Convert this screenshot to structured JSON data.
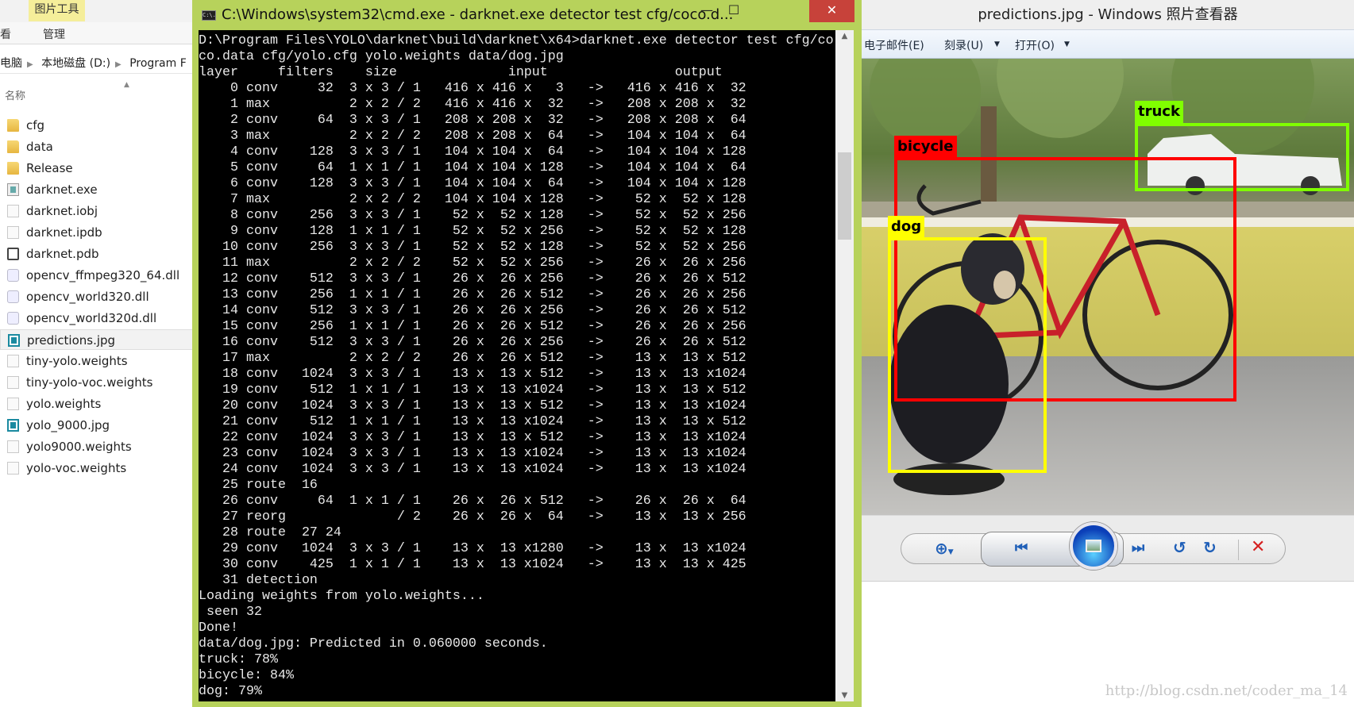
{
  "explorer": {
    "tool_tab": "图片工具",
    "ribbon_tabs": [
      "看",
      "管理"
    ],
    "breadcrumb": [
      "电脑",
      "本地磁盘 (D:)",
      "Program F"
    ],
    "column_name": "名称",
    "files": [
      {
        "name": "cfg",
        "icon": "folder"
      },
      {
        "name": "data",
        "icon": "folder"
      },
      {
        "name": "Release",
        "icon": "folder"
      },
      {
        "name": "darknet.exe",
        "icon": "exe"
      },
      {
        "name": "darknet.iobj",
        "icon": "doc"
      },
      {
        "name": "darknet.ipdb",
        "icon": "doc"
      },
      {
        "name": "darknet.pdb",
        "icon": "pdb"
      },
      {
        "name": "opencv_ffmpeg320_64.dll",
        "icon": "dll"
      },
      {
        "name": "opencv_world320.dll",
        "icon": "dll"
      },
      {
        "name": "opencv_world320d.dll",
        "icon": "dll"
      },
      {
        "name": "predictions.jpg",
        "icon": "img",
        "selected": true
      },
      {
        "name": "tiny-yolo.weights",
        "icon": "doc"
      },
      {
        "name": "tiny-yolo-voc.weights",
        "icon": "doc"
      },
      {
        "name": "yolo.weights",
        "icon": "doc"
      },
      {
        "name": "yolo_9000.jpg",
        "icon": "img"
      },
      {
        "name": "yolo9000.weights",
        "icon": "doc"
      },
      {
        "name": "yolo-voc.weights",
        "icon": "doc"
      }
    ]
  },
  "cmd": {
    "title": "C:\\Windows\\system32\\cmd.exe - darknet.exe  detector test cfg/coco.d...",
    "icon_text": "C:\\.",
    "minimize": "—",
    "maximize": "☐",
    "close": "✕",
    "lines": [
      "D:\\Program Files\\YOLO\\darknet\\build\\darknet\\x64>darknet.exe detector test cfg/co",
      "co.data cfg/yolo.cfg yolo.weights data/dog.jpg",
      "layer     filters    size              input                output",
      "    0 conv     32  3 x 3 / 1   416 x 416 x   3   ->   416 x 416 x  32",
      "    1 max          2 x 2 / 2   416 x 416 x  32   ->   208 x 208 x  32",
      "    2 conv     64  3 x 3 / 1   208 x 208 x  32   ->   208 x 208 x  64",
      "    3 max          2 x 2 / 2   208 x 208 x  64   ->   104 x 104 x  64",
      "    4 conv    128  3 x 3 / 1   104 x 104 x  64   ->   104 x 104 x 128",
      "    5 conv     64  1 x 1 / 1   104 x 104 x 128   ->   104 x 104 x  64",
      "    6 conv    128  3 x 3 / 1   104 x 104 x  64   ->   104 x 104 x 128",
      "    7 max          2 x 2 / 2   104 x 104 x 128   ->    52 x  52 x 128",
      "    8 conv    256  3 x 3 / 1    52 x  52 x 128   ->    52 x  52 x 256",
      "    9 conv    128  1 x 1 / 1    52 x  52 x 256   ->    52 x  52 x 128",
      "   10 conv    256  3 x 3 / 1    52 x  52 x 128   ->    52 x  52 x 256",
      "   11 max          2 x 2 / 2    52 x  52 x 256   ->    26 x  26 x 256",
      "   12 conv    512  3 x 3 / 1    26 x  26 x 256   ->    26 x  26 x 512",
      "   13 conv    256  1 x 1 / 1    26 x  26 x 512   ->    26 x  26 x 256",
      "   14 conv    512  3 x 3 / 1    26 x  26 x 256   ->    26 x  26 x 512",
      "   15 conv    256  1 x 1 / 1    26 x  26 x 512   ->    26 x  26 x 256",
      "   16 conv    512  3 x 3 / 1    26 x  26 x 256   ->    26 x  26 x 512",
      "   17 max          2 x 2 / 2    26 x  26 x 512   ->    13 x  13 x 512",
      "   18 conv   1024  3 x 3 / 1    13 x  13 x 512   ->    13 x  13 x1024",
      "   19 conv    512  1 x 1 / 1    13 x  13 x1024   ->    13 x  13 x 512",
      "   20 conv   1024  3 x 3 / 1    13 x  13 x 512   ->    13 x  13 x1024",
      "   21 conv    512  1 x 1 / 1    13 x  13 x1024   ->    13 x  13 x 512",
      "   22 conv   1024  3 x 3 / 1    13 x  13 x 512   ->    13 x  13 x1024",
      "   23 conv   1024  3 x 3 / 1    13 x  13 x1024   ->    13 x  13 x1024",
      "   24 conv   1024  3 x 3 / 1    13 x  13 x1024   ->    13 x  13 x1024",
      "   25 route  16",
      "   26 conv     64  1 x 1 / 1    26 x  26 x 512   ->    26 x  26 x  64",
      "   27 reorg              / 2    26 x  26 x  64   ->    13 x  13 x 256",
      "   28 route  27 24",
      "   29 conv   1024  3 x 3 / 1    13 x  13 x1280   ->    13 x  13 x1024",
      "   30 conv    425  1 x 1 / 1    13 x  13 x1024   ->    13 x  13 x 425",
      "   31 detection",
      "Loading weights from yolo.weights...",
      " seen 32",
      "Done!",
      "data/dog.jpg: Predicted in 0.060000 seconds.",
      "truck: 78%",
      "bicycle: 84%",
      "dog: 79%"
    ]
  },
  "viewer": {
    "title": "predictions.jpg - Windows 照片查看器",
    "menu": [
      "电子邮件(E)",
      "刻录(U)",
      "打开(O)"
    ],
    "detections": [
      {
        "label": "truck",
        "color": "#80ff00"
      },
      {
        "label": "bicycle",
        "color": "#ff0000"
      },
      {
        "label": "dog",
        "color": "#ffff00"
      }
    ],
    "controls": [
      "zoom-icon",
      "actual-size-icon",
      "previous-icon",
      "slideshow-icon",
      "next-icon",
      "rotate-ccw-icon",
      "rotate-cw-icon",
      "delete-icon"
    ]
  },
  "watermark": "http://blog.csdn.net/coder_ma_14"
}
